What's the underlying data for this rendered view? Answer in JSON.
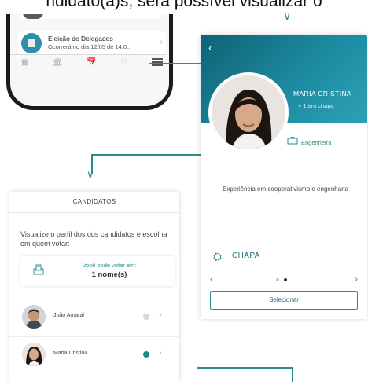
{
  "caption": {
    "text": "ndidato(a)s, será possível visualizar o",
    "arrow": "∨"
  },
  "phone": {
    "card_title": "Eleição de Delegados",
    "card_subtitle": "Ocorrerá no dia 12/05 de 14:0...",
    "chevron": "›",
    "nav_icons": [
      "▦",
      "🏛",
      "📅",
      "♡"
    ]
  },
  "profile": {
    "back": "‹",
    "name": "MARIA CRISTINA",
    "subtitle": "+ 1 em chapa",
    "profession": "Engenheira",
    "description": "Experiência em cooperativismo e engenharia",
    "chapa_label": "CHAPA",
    "prev": "‹",
    "next": "›",
    "select_label": "Selecionar"
  },
  "candidates": {
    "header": "CANDIDATOS",
    "intro": "Visualize o perfil dos dos candidatos e escolha em quem votar:",
    "vote_label": "Você pode votar em:",
    "vote_count": "1 nome(s)",
    "rows": [
      {
        "name": "João Amaral",
        "selected": false
      },
      {
        "name": "Maria Cristina",
        "selected": true
      }
    ],
    "chevron": "›"
  },
  "colors": {
    "accent": "#2a8c8c",
    "header_teal": "#1d8da3",
    "selected": "#1e8c82"
  }
}
